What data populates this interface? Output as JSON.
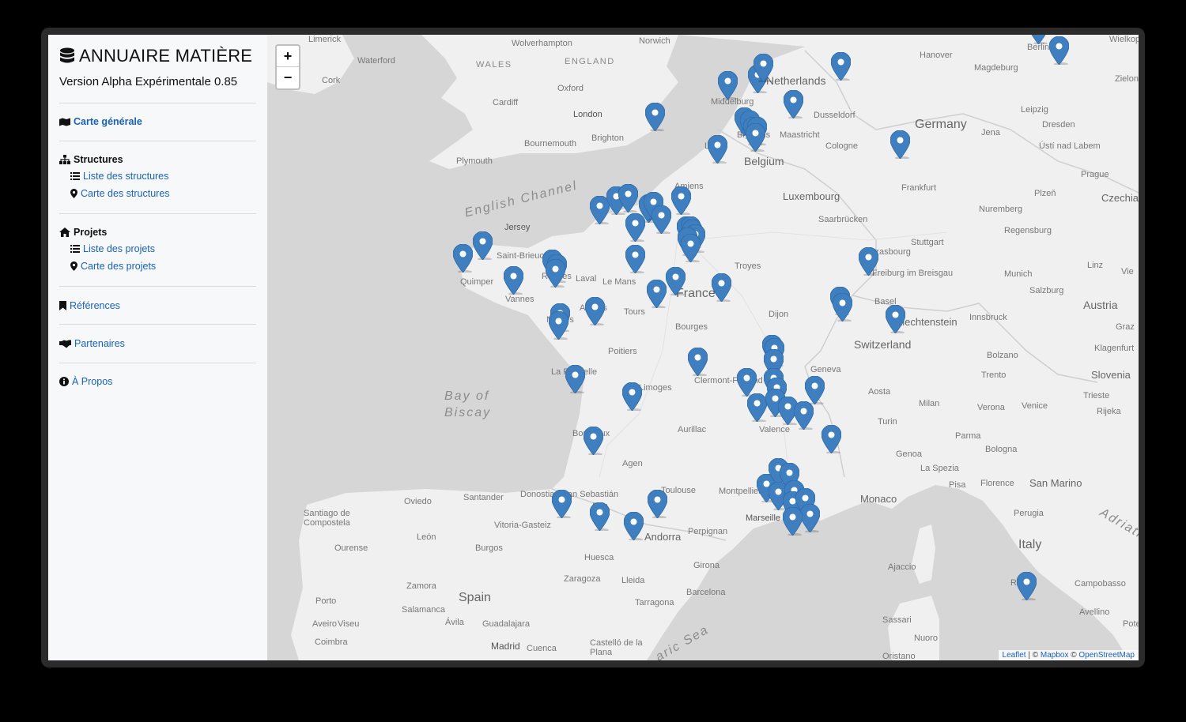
{
  "app": {
    "title": "ANNUAIRE MATIÈRE",
    "version": "Version Alpha Expérimentale 0.85"
  },
  "nav": {
    "carte_generale": "Carte générale",
    "structures": {
      "heading": "Structures",
      "liste": "Liste des structures",
      "carte": "Carte des structures"
    },
    "projets": {
      "heading": "Projets",
      "liste": "Liste des projets",
      "carte": "Carte des projets"
    },
    "references": "Références",
    "partenaires": "Partenaires",
    "a_propos": "À Propos"
  },
  "map": {
    "zoom_in": "+",
    "zoom_out": "−",
    "attribution": {
      "leaflet": "Leaflet",
      "sep1": " | © ",
      "mapbox": "Mapbox",
      "sep2": " © ",
      "osm": "OpenStreetMap"
    },
    "marker_color": "#3f7fc0",
    "labels": {
      "countries": [
        "Germany",
        "France",
        "Belgium",
        "Luxembourg",
        "Switzerland",
        "Austria",
        "Spain",
        "Italy",
        "Netherlands",
        "Czechia",
        "Slovenia",
        "Liechtenstein",
        "Andorra",
        "Monaco",
        "San Marino"
      ],
      "seas": [
        "English Channel",
        "Bay of",
        "Biscay",
        "aric Sea",
        "Adriati"
      ],
      "regions": [
        "WALES",
        "ENGLAND"
      ],
      "cities": [
        "Limerick",
        "Wolverhampton",
        "Norwich",
        "Waterford",
        "Cork",
        "Oxford",
        "London",
        "Cardiff",
        "Brighton",
        "Bournemouth",
        "Plymouth",
        "Jersey",
        "Saint-Brieuc",
        "Rennes",
        "Laval",
        "Le Mans",
        "Quimper",
        "Vannes",
        "Nantes",
        "Angers",
        "Tours",
        "Amiens",
        "Brussels",
        "Lille",
        "Maastricht",
        "Middelburg",
        "Hanover",
        "Magdeburg",
        "Berlin",
        "Wielkopolska",
        "Zielona G",
        "Leipzig",
        "Dresden",
        "Ústí nad Labem",
        "Jena",
        "Dusseldorf",
        "Cologne",
        "Frankfurt",
        "Prague",
        "Plzeň",
        "Nuremberg",
        "Regensburg",
        "Saarbrücken",
        "Stuttgart",
        "Strasbourg",
        "Freiburg im Breisgau",
        "Basel",
        "Munich",
        "Salzburg",
        "Linz",
        "Vie",
        "Innsbruck",
        "Graz",
        "Klagenfurt",
        "Bolzano",
        "Trento",
        "Troyes",
        "Dijon",
        "Bourges",
        "Poitiers",
        "La Rochelle",
        "Limoges",
        "Clermont-Ferrand",
        "Geneva",
        "Aosta",
        "Milan",
        "Verona",
        "Venice",
        "Trieste",
        "Rijeka",
        "Turin",
        "Parma",
        "Bologna",
        "Genoa",
        "La Spezia",
        "Pisa",
        "Florence",
        "Perugia",
        "Rome",
        "Campobasso",
        "Avellino",
        "Pote",
        "Valence",
        "Aurillac",
        "Agen",
        "Bordeaux",
        "Toulouse",
        "Pau",
        "Donostia / San Sebastián",
        "Santander",
        "Oviedo",
        "Santiago de Compostela",
        "Ourense",
        "León",
        "Burgos",
        "Vitoria-Gasteiz",
        "Huesca",
        "Zaragoza",
        "Lleida",
        "Girona",
        "Perpignan",
        "Montpellier",
        "Marseille",
        "Barcelona",
        "Tarragona",
        "Castelló de la Plana",
        "Madrid",
        "Cuenca",
        "Ávila",
        "Guadalajara",
        "Salamanca",
        "Zamora",
        "Porto",
        "Aveiro",
        "Viseu",
        "Coimbra",
        "Ajaccio",
        "Sassari",
        "Nuoro",
        "Oristano",
        "Tours",
        "Amiens"
      ]
    }
  }
}
